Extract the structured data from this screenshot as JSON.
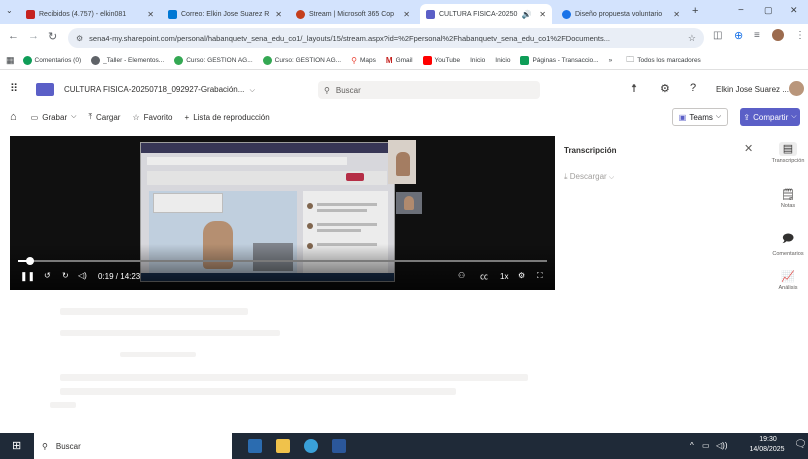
{
  "browser": {
    "tabs": [
      {
        "label": "Recibidos (4.757) - elkin081",
        "favicon_color": "#c5221f",
        "favicon": "gmail-icon"
      },
      {
        "label": "Correo: Elkin Jose Suarez R",
        "favicon_color": "#0078d4",
        "favicon": "outlook-icon"
      },
      {
        "label": "Stream | Microsoft 365 Cop",
        "favicon_color": "#c43e1c",
        "favicon": "stream-icon"
      },
      {
        "label": "CULTURA FISICA-20250",
        "favicon_color": "#5b5fc7",
        "favicon": "video-icon",
        "active": true
      },
      {
        "label": "Diseño propuesta voluntario",
        "favicon_color": "#1a73e8",
        "favicon": "doc-icon"
      }
    ],
    "new_tab": "+",
    "window_controls": {
      "minimize": "−",
      "maximize": "▢",
      "close": "✕"
    },
    "url": "sena4-my.sharepoint.com/personal/habanquetv_sena_edu_co1/_layouts/15/stream.aspx?id=%2Fpersonal%2Fhabanquetv_sena_edu_co1%2FDocuments...",
    "bookmarks": [
      {
        "label": "Comentarios (0)",
        "color": "#0f9d58"
      },
      {
        "label": "_Taller - Elementos...",
        "color": "#5f6368"
      },
      {
        "label": "Curso: GESTION AG...",
        "color": "#34a853"
      },
      {
        "label": "Curso: GESTION AG...",
        "color": "#34a853"
      },
      {
        "label": "Maps",
        "color": "#ea4335"
      },
      {
        "label": "Gmail",
        "color": "#c5221f"
      },
      {
        "label": "YouTube",
        "color": "#ff0000"
      },
      {
        "label": "Inicio",
        "color": "#ffffff"
      },
      {
        "label": "Inicio",
        "color": "#ffffff"
      },
      {
        "label": "Páginas - Transaccio...",
        "color": "#0f9d58"
      }
    ],
    "bookmarks_more": "»",
    "all_bookmarks": "Todos los marcadores"
  },
  "sharepoint": {
    "file_title": "CULTURA FISICA-20250718_092927-Grabación...",
    "search_placeholder": "Buscar",
    "user_name": "Elkin Jose Suarez ..."
  },
  "command_bar": {
    "grabar": "Grabar",
    "cargar": "Cargar",
    "favorito": "Favorito",
    "lista": "Lista de reproducción",
    "teams": "Teams",
    "compartir": "Compartir"
  },
  "player": {
    "time": "0:19 / 14:23",
    "progress": 0.022,
    "speed": "1x"
  },
  "transcript": {
    "title": "Transcripción",
    "download": "Descargar"
  },
  "rail": [
    {
      "label": "Transcripción",
      "icon": "transcript-icon"
    },
    {
      "label": "Notas",
      "icon": "notes-icon"
    },
    {
      "label": "Comentarios",
      "icon": "comments-icon"
    },
    {
      "label": "Análisis",
      "icon": "analytics-icon"
    }
  ],
  "taskbar": {
    "search": "Buscar",
    "time": "19:30",
    "date": "14/08/2025"
  }
}
